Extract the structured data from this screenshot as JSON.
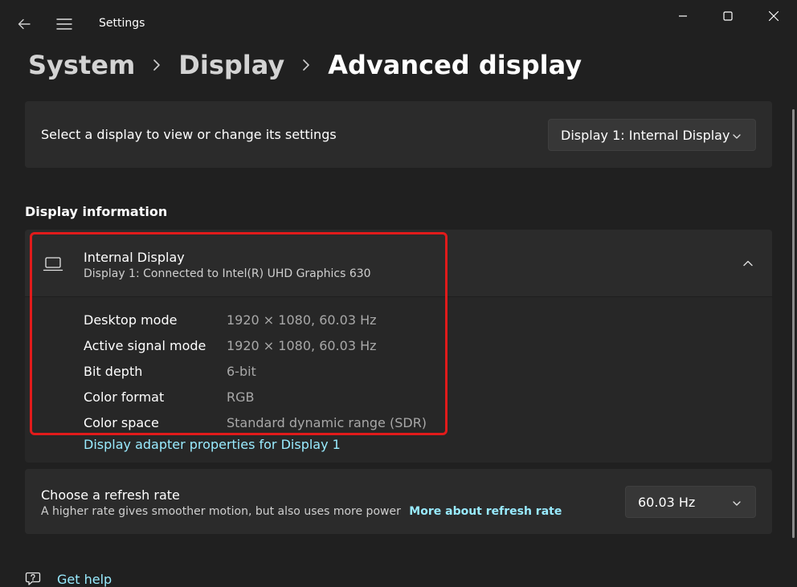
{
  "window": {
    "title": "Settings"
  },
  "breadcrumb": {
    "items": [
      "System",
      "Display",
      "Advanced display"
    ]
  },
  "display_select": {
    "label": "Select a display to view or change its settings",
    "selected": "Display 1: Internal Display"
  },
  "display_info": {
    "section_title": "Display information",
    "name": "Internal Display",
    "subtitle": "Display 1: Connected to Intel(R) UHD Graphics 630",
    "rows": [
      {
        "key": "Desktop mode",
        "value": "1920 × 1080, 60.03 Hz"
      },
      {
        "key": "Active signal mode",
        "value": "1920 × 1080, 60.03 Hz"
      },
      {
        "key": "Bit depth",
        "value": "6-bit"
      },
      {
        "key": "Color format",
        "value": "RGB"
      },
      {
        "key": "Color space",
        "value": "Standard dynamic range (SDR)"
      }
    ],
    "adapter_link": "Display adapter properties for Display 1"
  },
  "refresh_rate": {
    "title": "Choose a refresh rate",
    "description": "A higher rate gives smoother motion, but also uses more power",
    "link": "More about refresh rate",
    "selected": "60.03 Hz"
  },
  "help": {
    "label": "Get help"
  },
  "icons": {
    "back": "back-arrow-icon",
    "menu": "hamburger-menu-icon",
    "minimize": "minimize-icon",
    "maximize": "maximize-icon",
    "close": "close-icon",
    "laptop": "laptop-icon",
    "chevron_down": "chevron-down-icon",
    "chevron_up": "chevron-up-icon",
    "help": "help-chat-icon"
  },
  "colors": {
    "background": "#202020",
    "card": "#2b2b2b",
    "accent_link": "#99ebff",
    "highlight": "#e11b1b"
  }
}
